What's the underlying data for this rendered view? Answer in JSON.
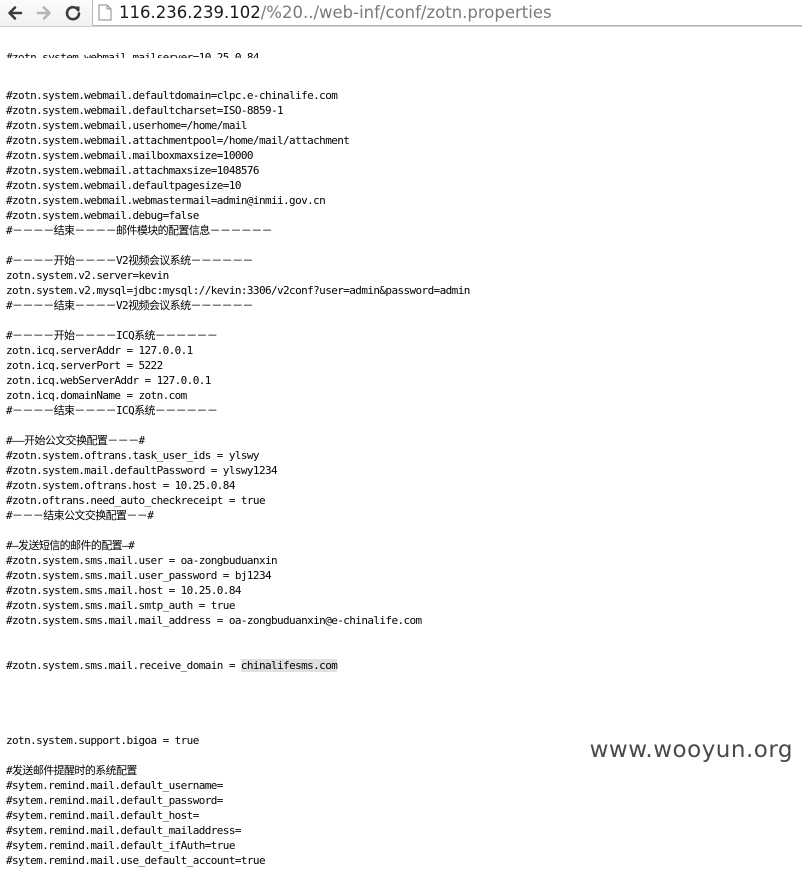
{
  "browser": {
    "url_host": "116.236.239.102",
    "url_path": "/%20../web-inf/conf/zotn.properties",
    "icons": [
      "back-arrow-icon",
      "forward-arrow-icon",
      "reload-icon",
      "page-icon"
    ]
  },
  "file": {
    "top_partial_line": "#zotn.system.webmail.mailserver=10.25.0.84",
    "lines": [
      "#zotn.system.webmail.defaultdomain=clpc.e-chinalife.com",
      "#zotn.system.webmail.defaultcharset=ISO-8859-1",
      "#zotn.system.webmail.userhome=/home/mail",
      "#zotn.system.webmail.attachmentpool=/home/mail/attachment",
      "#zotn.system.webmail.mailboxmaxsize=10000",
      "#zotn.system.webmail.attachmaxsize=1048576",
      "#zotn.system.webmail.defaultpagesize=10",
      "#zotn.system.webmail.webmastermail=admin@inmii.gov.cn",
      "#zotn.system.webmail.debug=false",
      "#－－－－结束－－－－邮件模块的配置信息－－－－－－",
      "",
      "#－－－－开始－－－－V2视频会议系统－－－－－－",
      "zotn.system.v2.server=kevin",
      "zotn.system.v2.mysql=jdbc:mysql://kevin:3306/v2conf?user=admin&password=admin",
      "#－－－－结束－－－－V2视频会议系统－－－－－－",
      "",
      "#－－－－开始－－－－ICQ系统－－－－－－",
      "zotn.icq.serverAddr = 127.0.0.1",
      "zotn.icq.serverPort = 5222",
      "zotn.icq.webServerAddr = 127.0.0.1",
      "zotn.icq.domainName = zotn.com",
      "#－－－－结束－－－－ICQ系统－－－－－－",
      "",
      "#——开始公文交换配置－－－#",
      "#zotn.system.oftrans.task_user_ids = ylswy",
      "#zotn.system.mail.defaultPassword = ylswy1234",
      "#zotn.system.oftrans.host = 10.25.0.84",
      "#zotn.oftrans.need_auto_checkreceipt = true",
      "#－－－结束公文交换配置－－#",
      "",
      "#—发送短信的邮件的配置—#",
      "#zotn.system.sms.mail.user = oa-zongbuduanxin",
      "#zotn.system.sms.mail.user_password = bj1234",
      "#zotn.system.sms.mail.host = 10.25.0.84",
      "#zotn.system.sms.mail.smtp_auth = true",
      "#zotn.system.sms.mail.mail_address = oa-zongbuduanxin@e-chinalife.com"
    ],
    "receive_domain_prefix": "#zotn.system.sms.mail.receive_domain = ",
    "receive_domain_selected": "chinalifesms.com",
    "lines_after": [
      "",
      "",
      "zotn.system.support.bigoa = true",
      "",
      "#发送邮件提醒时的系统配置",
      "#sytem.remind.mail.default_username=",
      "#sytem.remind.mail.default_password=",
      "#sytem.remind.mail.default_host=",
      "#sytem.remind.mail.default_mailaddress=",
      "#sytem.remind.mail.default_ifAuth=true",
      "#sytem.remind.mail.use_default_account=true"
    ]
  },
  "watermark": "www.wooyun.org"
}
